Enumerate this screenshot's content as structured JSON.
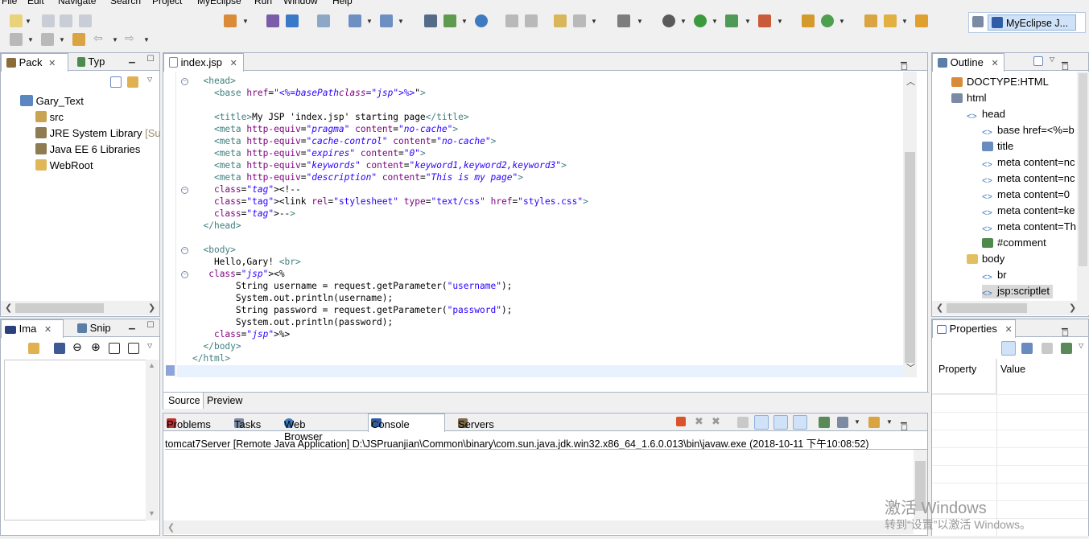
{
  "menu": [
    "File",
    "Edit",
    "Navigate",
    "Search",
    "Project",
    "MyEclipse",
    "Run",
    "Window",
    "Help"
  ],
  "perspective": {
    "label": "MyEclipse J..."
  },
  "package_explorer": {
    "tabs": [
      "Pack",
      "Typ"
    ],
    "items": [
      {
        "label": "Gary_Text",
        "icon": "project-icon"
      },
      {
        "label": "src",
        "icon": "source-folder-icon"
      },
      {
        "label": "JRE System Library",
        "suffix": "[Su",
        "icon": "library-icon"
      },
      {
        "label": "Java EE 6 Libraries",
        "icon": "library-icon"
      },
      {
        "label": "WebRoot",
        "icon": "folder-icon"
      }
    ]
  },
  "image_view": {
    "tabs": [
      "Ima",
      "Snip"
    ]
  },
  "editor": {
    "tab": "index.jsp",
    "bottom_tabs": [
      "Source",
      "Preview"
    ],
    "lines": [
      "  <head>",
      "    <base href=\"<%=basePath%>\">",
      "",
      "    <title>My JSP 'index.jsp' starting page</title>",
      "    <meta http-equiv=\"pragma\" content=\"no-cache\">",
      "    <meta http-equiv=\"cache-control\" content=\"no-cache\">",
      "    <meta http-equiv=\"expires\" content=\"0\">",
      "    <meta http-equiv=\"keywords\" content=\"keyword1,keyword2,keyword3\">",
      "    <meta http-equiv=\"description\" content=\"This is my page\">",
      "    <!--",
      "    <link rel=\"stylesheet\" type=\"text/css\" href=\"styles.css\">",
      "    -->",
      "  </head>",
      "",
      "  <body>",
      "    Hello,Gary! <br>",
      "   <%",
      "        String username = request.getParameter(\"username\");",
      "        System.out.println(username);",
      "        String password = request.getParameter(\"password\");",
      "        System.out.println(password);",
      "    %>",
      "  </body>",
      "</html>"
    ]
  },
  "outline": {
    "tab": "Outline",
    "items": [
      {
        "label": "DOCTYPE:HTML"
      },
      {
        "label": "html"
      },
      {
        "label": "head"
      },
      {
        "label": "base href=<%=b"
      },
      {
        "label": "title"
      },
      {
        "label": "meta content=nc"
      },
      {
        "label": "meta content=nc"
      },
      {
        "label": "meta content=0"
      },
      {
        "label": "meta content=ke"
      },
      {
        "label": "meta content=Th"
      },
      {
        "label": "#comment"
      },
      {
        "label": "body"
      },
      {
        "label": "br"
      },
      {
        "label": "jsp:scriptlet"
      }
    ]
  },
  "properties": {
    "tab": "Properties",
    "col_property": "Property",
    "col_value": "Value"
  },
  "console": {
    "tabs": [
      "Problems",
      "Tasks",
      "Web Browser",
      "Console",
      "Servers"
    ],
    "header": "tomcat7Server [Remote Java Application] D:\\JSPruanjian\\Common\\binary\\com.sun.java.jdk.win32.x86_64_1.6.0.013\\bin\\javaw.exe (2018-10-11 下午10:08:52)"
  },
  "watermark": {
    "line1": "激活 Windows",
    "line2": "转到“设置”以激活 Windows。"
  },
  "colors": {
    "accent": "#cfe2f7",
    "tag": "#3f7f7f",
    "attr": "#7f007f",
    "value": "#2a00ff"
  }
}
